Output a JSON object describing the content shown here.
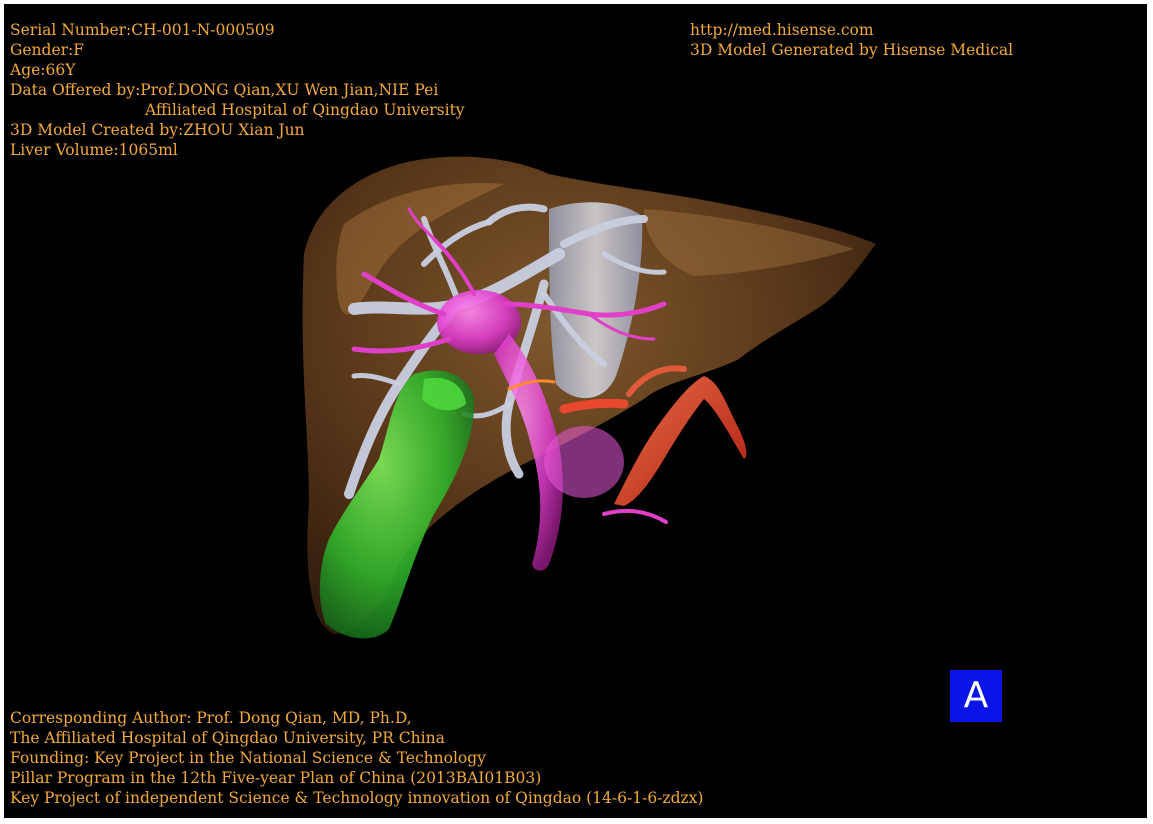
{
  "top_left_info": {
    "serial_number": "Serial Number:CH-001-N-000509",
    "gender": "Gender:F",
    "age": "Age:66Y",
    "data_offered_by": "Data Offered by:Prof.DONG Qian,XU Wen Jian,NIE Pei",
    "hospital": "Affiliated Hospital of Qingdao University",
    "model_created_by": "3D Model Created by:ZHOU Xian Jun",
    "liver_volume": "Liver Volume:1065ml"
  },
  "top_right_info": {
    "url": "http://med.hisense.com",
    "generator": "3D Model Generated by Hisense Medical"
  },
  "bottom_left_info": {
    "corresponding_author": "Corresponding Author: Prof. Dong Qian, MD, Ph.D,",
    "affiliation": "The Affiliated Hospital of Qingdao University, PR China",
    "founding": "Founding: Key Project in the National Science & Technology",
    "pillar_program": "Pillar Program in the 12th Five-year Plan of China (2013BAI01B03)",
    "key_project": "Key Project of independent Science & Technology innovation of Qingdao (14-6-1-6-zdzx)"
  },
  "badge": {
    "label": "A",
    "color": "#0a14e6"
  },
  "colors": {
    "background": "#000000",
    "frame": "#ffffff",
    "text": "#f2a93b",
    "liver": "#8a5a2b",
    "hepatic_vein": "#c8ccd8",
    "portal_vein": "#e040c8",
    "artery": "#e0402a",
    "gallbladder": "#3cc83a"
  }
}
